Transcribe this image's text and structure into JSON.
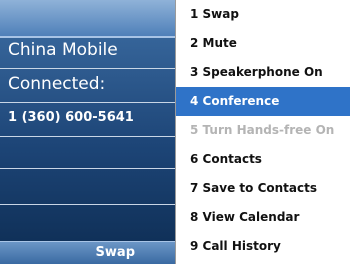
{
  "call_screen": {
    "operator": "China Mobile",
    "status": "Connected:",
    "phone_number": "1 (360) 600-5641",
    "softkey_label": "Swap"
  },
  "menu": {
    "items": [
      {
        "label": "1 Swap",
        "state": "normal"
      },
      {
        "label": "2 Mute",
        "state": "normal"
      },
      {
        "label": "3 Speakerphone On",
        "state": "normal"
      },
      {
        "label": "4 Conference",
        "state": "selected"
      },
      {
        "label": "5 Turn Hands-free On",
        "state": "disabled"
      },
      {
        "label": "6 Contacts",
        "state": "normal"
      },
      {
        "label": "7 Save to Contacts",
        "state": "normal"
      },
      {
        "label": "8 View Calendar",
        "state": "normal"
      },
      {
        "label": "9 Call History",
        "state": "normal"
      }
    ]
  },
  "colors": {
    "panel_dark": "#1d4577",
    "panel_light": "#4f80b9",
    "selection": "#2f73c8",
    "disabled_text": "#b4b4b4"
  }
}
